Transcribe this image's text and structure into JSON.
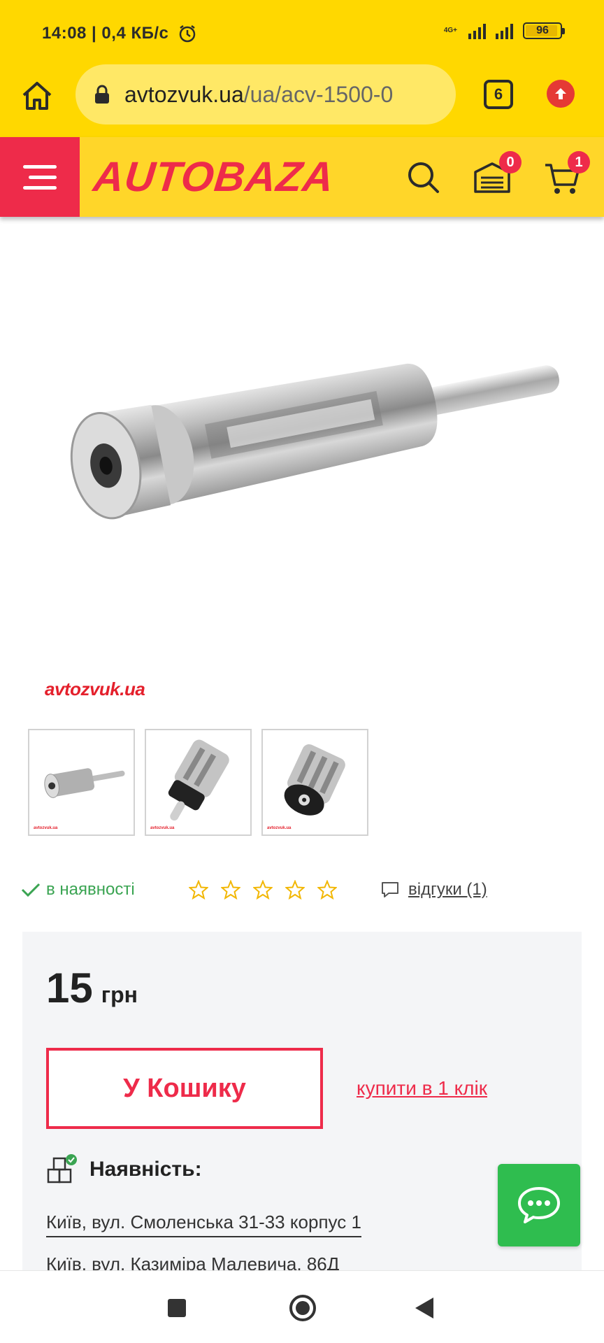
{
  "status_bar": {
    "time": "14:08 | 0,4 КБ/с",
    "network": "4G+",
    "battery": "96"
  },
  "browser": {
    "url_host": "avtozvuk.ua",
    "url_path": "/ua/acv-1500-0",
    "tab_count": "6"
  },
  "header": {
    "logo": "AUTOBAZA",
    "garage_badge": "0",
    "cart_badge": "1",
    "accent_color": "#ee2b4a",
    "header_color": "#ffd629"
  },
  "product": {
    "image_watermark": "avtozvuk.ua",
    "thumbnails": [
      {
        "alt": "antenna-adapter-side-view",
        "wm": "avtozvuk.ua"
      },
      {
        "alt": "antenna-adapter-plug-view",
        "wm": "avtozvuk.ua"
      },
      {
        "alt": "antenna-adapter-socket-view",
        "wm": "avtozvuk.ua"
      }
    ],
    "stock_label": "в наявності",
    "rating_stars": 0,
    "reviews_label": "відгуки (1)",
    "price_amount": "15",
    "price_currency": "грн",
    "cart_button": "У Кошику",
    "one_click_label": "купити в 1 клік",
    "availability_title": "Наявність:",
    "addresses": [
      "Київ, вул. Смоленська 31-33 корпус 1",
      "Київ, вул. Казиміра Малевича, 86Д"
    ]
  }
}
